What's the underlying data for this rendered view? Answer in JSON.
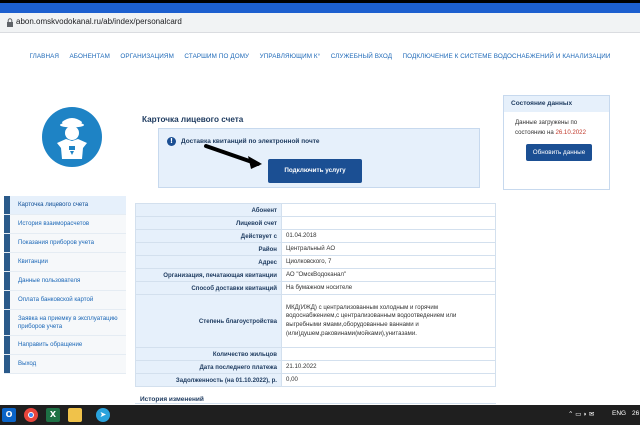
{
  "browser": {
    "url": "abon.omskvodokanal.ru/ab/index/personalcard"
  },
  "nav": {
    "items": [
      "ГЛАВНАЯ",
      "АБОНЕНТАМ",
      "ОРГАНИЗАЦИЯМ",
      "СТАРШИМ ПО ДОМУ",
      "УПРАВЛЯЮЩИМ К°",
      "СЛУЖЕБНЫЙ ВХОД",
      "ПОДКЛЮЧЕНИЕ К СИСТЕМЕ ВОДОСНАБЖЕНИЙ И КАНАЛИЗАЦИИ"
    ]
  },
  "sidebar": {
    "items": [
      "Карточка лицевого счета",
      "История взаиморасчетов",
      "Показания приборов учета",
      "Квитанции",
      "Данные пользователя",
      "Оплата банковской картой",
      "Заявка на приемку в эксплуатацию приборов учета",
      "Направить обращение",
      "Выход"
    ]
  },
  "card": {
    "title": "Карточка лицевого счета",
    "notice_text": "Доставка квитанций по электронной почте",
    "connect_label": "Подключить услугу"
  },
  "status": {
    "title": "Состояние данных",
    "line1": "Данные загружены по",
    "line2_prefix": "состоянию на ",
    "date": "26.10.2022",
    "refresh_label": "Обновить данные"
  },
  "table": {
    "rows": [
      {
        "label": "Абонент",
        "value": ""
      },
      {
        "label": "Лицевой счет",
        "value": ""
      },
      {
        "label": "Действует с",
        "value": "01.04.2018"
      },
      {
        "label": "Район",
        "value": "Центральный АО"
      },
      {
        "label": "Адрес",
        "value": "Циолковского, 7"
      },
      {
        "label": "Организация, печатающая квитанции",
        "value": "АО \"ОмскВодоканал\""
      },
      {
        "label": "Способ доставки квитанций",
        "value": "На бумажном носителе"
      },
      {
        "label": "Степень благоустройства",
        "value": "МКД(ИЖД) с централизованным холодным и горячим водоснабжением,с централизованным водоотведением или выгребными ямами,оборудованные ваннами и (или)душем,раковинами(мойками),унитазами."
      },
      {
        "label": "Количество жильцов",
        "value": ""
      },
      {
        "label": "Дата последнего платежа",
        "value": "21.10.2022"
      },
      {
        "label": "Задолженность (на 01.10.2022), р.",
        "value": "0,00"
      }
    ]
  },
  "history": {
    "title": "История изменений"
  },
  "taskbar": {
    "lang": "ENG",
    "clock": "26"
  },
  "colors": {
    "link": "#1b67b7",
    "accent": "#1b4f93",
    "status_date": "#c0392b",
    "header_blue": "#1c5fcf"
  }
}
